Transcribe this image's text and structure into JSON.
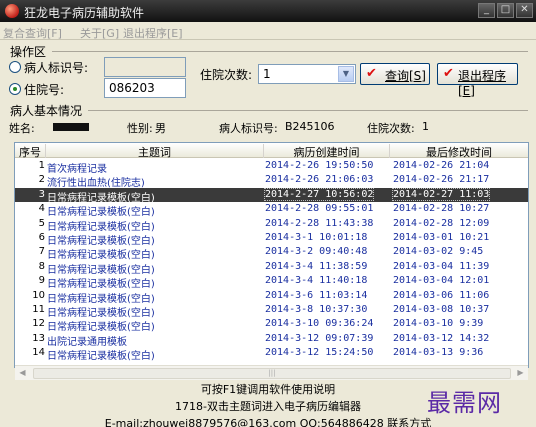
{
  "window": {
    "title": "狂龙电子病历辅助软件",
    "minimize": "_",
    "maximize": "□",
    "close": "✕"
  },
  "menu": [
    "复合查询[F]",
    "关于[G]",
    "退出程序[E]"
  ],
  "ops": {
    "group_label": "操作区",
    "patient_id_label": "病人标识号:",
    "patient_id_value": "",
    "hosp_no_label": "住院号:",
    "hosp_no_value": "086203",
    "visits_label": "住院次数:",
    "visits_value": "1",
    "query_button": "查询[S]",
    "exit_button": "退出程序[E]"
  },
  "patient": {
    "group_label": "病人基本情况",
    "name_label": "姓名:",
    "gender_label": "性别:",
    "gender_value": "男",
    "id_label": "病人标识号:",
    "id_value": "B245106",
    "visits_label": "住院次数:",
    "visits_value": "1"
  },
  "table": {
    "columns": [
      "序号",
      "主题词",
      "病历创建时间",
      "最后修改时间"
    ],
    "selected_index": 2,
    "rows": [
      {
        "num": "1",
        "topic": "首次病程记录",
        "created": "2014-2-26 19:50:50",
        "modified": "2014-02-26 21:04"
      },
      {
        "num": "2",
        "topic": "流行性出血热(住院志)",
        "created": "2014-2-26 21:06:03",
        "modified": "2014-02-26 21:17"
      },
      {
        "num": "3",
        "topic": "日常病程记录模板(空白)",
        "created": "2014-2-27 10:56:02",
        "modified": "2014-02-27 11:03"
      },
      {
        "num": "4",
        "topic": "日常病程记录模板(空白)",
        "created": "2014-2-28 09:55:01",
        "modified": "2014-02-28 10:27"
      },
      {
        "num": "5",
        "topic": "日常病程记录模板(空白)",
        "created": "2014-2-28 11:43:38",
        "modified": "2014-02-28 12:09"
      },
      {
        "num": "6",
        "topic": "日常病程记录模板(空白)",
        "created": "2014-3-1 10:01:18",
        "modified": "2014-03-01 10:21"
      },
      {
        "num": "7",
        "topic": "日常病程记录模板(空白)",
        "created": "2014-3-2 09:40:48",
        "modified": "2014-03-02 9:45"
      },
      {
        "num": "8",
        "topic": "日常病程记录模板(空白)",
        "created": "2014-3-4 11:38:59",
        "modified": "2014-03-04 11:39"
      },
      {
        "num": "9",
        "topic": "日常病程记录模板(空白)",
        "created": "2014-3-4 11:40:18",
        "modified": "2014-03-04 12:01"
      },
      {
        "num": "10",
        "topic": "日常病程记录模板(空白)",
        "created": "2014-3-6 11:03:14",
        "modified": "2014-03-06 11:06"
      },
      {
        "num": "11",
        "topic": "日常病程记录模板(空白)",
        "created": "2014-3-8 10:37:30",
        "modified": "2014-03-08 10:37"
      },
      {
        "num": "12",
        "topic": "日常病程记录模板(空白)",
        "created": "2014-3-10 09:36:24",
        "modified": "2014-03-10 9:39"
      },
      {
        "num": "13",
        "topic": "出院记录通用模板",
        "created": "2014-3-12 09:07:39",
        "modified": "2014-03-12 14:32"
      },
      {
        "num": "14",
        "topic": "日常病程记录模板(空白)",
        "created": "2014-3-12 15:24:50",
        "modified": "2014-03-13 9:36"
      }
    ]
  },
  "footer": {
    "line1": "可按F1键调用软件使用说明",
    "line2": "1718-双击主题词进入电子病历编辑器",
    "line3": "E-mail:zhouwei8879576@163.com QQ:564886428 联系方式",
    "watermark": "最需网"
  },
  "colors": {
    "accent": "#1a2fa0",
    "selected_row": "#3a3a3a",
    "watermark": "#5b2aa6"
  }
}
